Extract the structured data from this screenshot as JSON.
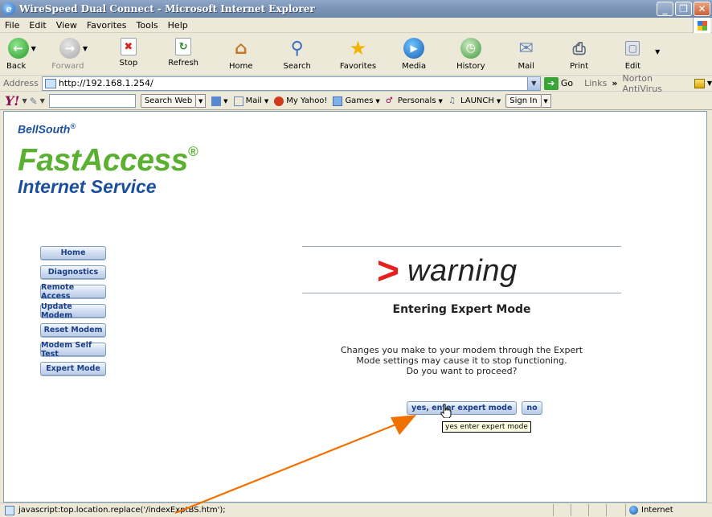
{
  "window": {
    "title": "WireSpeed Dual Connect - Microsoft Internet Explorer"
  },
  "menu": [
    "File",
    "Edit",
    "View",
    "Favorites",
    "Tools",
    "Help"
  ],
  "toolbar": {
    "back": "Back",
    "forward": "Forward",
    "stop": "Stop",
    "refresh": "Refresh",
    "home": "Home",
    "search": "Search",
    "favorites": "Favorites",
    "media": "Media",
    "history": "History",
    "mail": "Mail",
    "print": "Print",
    "edit": "Edit"
  },
  "address": {
    "label": "Address",
    "url": "http://192.168.1.254/",
    "go": "Go",
    "links": "Links",
    "norton": "Norton AntiVirus"
  },
  "yahoo": {
    "search_web": "Search Web",
    "mail": "Mail",
    "my_yahoo": "My Yahoo!",
    "games": "Games",
    "personals": "Personals",
    "launch": "LAUNCH",
    "sign_in": "Sign In"
  },
  "logo": {
    "bellsouth": "BellSouth",
    "reg": "®",
    "fastaccess": "FastAccess",
    "internet_service": "Internet Service"
  },
  "sidenav": {
    "items": [
      "Home",
      "Diagnostics",
      "Remote Access",
      "Update Modem",
      "Reset Modem",
      "Modem Self Test",
      "Expert Mode"
    ]
  },
  "page": {
    "warning_mark": ">",
    "warning_word": "warning",
    "heading": "Entering Expert Mode",
    "message_lines": [
      "Changes you make to your modem through the Expert",
      "Mode settings may cause it to stop functioning.",
      "Do you want to proceed?"
    ],
    "yes_button": "yes, enter expert mode",
    "no_button": "no",
    "tooltip": "yes enter expert mode"
  },
  "status": {
    "text": "javascript:top.location.replace('/indexExptBS.htm');",
    "zone": "Internet"
  },
  "colors": {
    "brand_green": "#5ab030",
    "brand_blue": "#1b4f9e",
    "warning_red": "#e6201c",
    "annotation_orange": "#f07000"
  }
}
